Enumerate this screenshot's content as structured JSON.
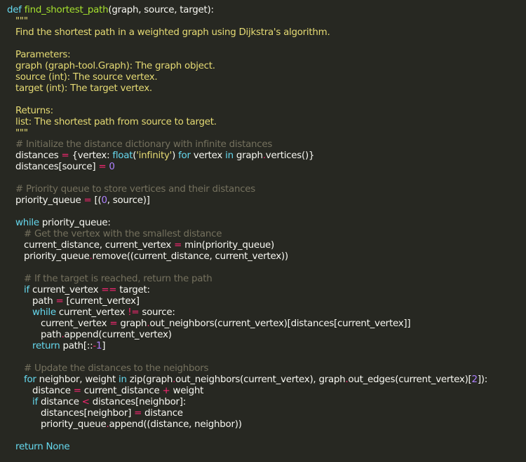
{
  "code_lines": [
    {
      "indent": 0,
      "tokens": [
        [
          "kw",
          "def"
        ],
        [
          "t",
          " "
        ],
        [
          "fn",
          "find_shortest_path"
        ],
        [
          "t",
          "(graph, source, target):"
        ]
      ]
    },
    {
      "indent": 1,
      "tokens": [
        [
          "doc",
          "\"\"\""
        ]
      ]
    },
    {
      "indent": 1,
      "tokens": [
        [
          "doc",
          "Find the shortest path in a weighted graph using Dijkstra's algorithm."
        ]
      ]
    },
    {
      "indent": 1,
      "tokens": []
    },
    {
      "indent": 1,
      "tokens": [
        [
          "doc",
          "Parameters:"
        ]
      ]
    },
    {
      "indent": 1,
      "tokens": [
        [
          "doc",
          "graph (graph-tool.Graph): The graph object."
        ]
      ]
    },
    {
      "indent": 1,
      "tokens": [
        [
          "doc",
          "source (int): The source vertex."
        ]
      ]
    },
    {
      "indent": 1,
      "tokens": [
        [
          "doc",
          "target (int): The target vertex."
        ]
      ]
    },
    {
      "indent": 1,
      "tokens": []
    },
    {
      "indent": 1,
      "tokens": [
        [
          "doc",
          "Returns:"
        ]
      ]
    },
    {
      "indent": 1,
      "tokens": [
        [
          "doc",
          "list: The shortest path from source to target."
        ]
      ]
    },
    {
      "indent": 1,
      "tokens": [
        [
          "doc",
          "\"\"\""
        ]
      ]
    },
    {
      "indent": 1,
      "tokens": [
        [
          "cm",
          "# Initialize the distance dictionary with infinite distances"
        ]
      ]
    },
    {
      "indent": 1,
      "tokens": [
        [
          "t",
          "distances "
        ],
        [
          "op",
          "="
        ],
        [
          "t",
          " {vertex: "
        ],
        [
          "kw",
          "float"
        ],
        [
          "t",
          "("
        ],
        [
          "str",
          "'infinity'"
        ],
        [
          "t",
          ") "
        ],
        [
          "kw",
          "for"
        ],
        [
          "t",
          " vertex "
        ],
        [
          "kw",
          "in"
        ],
        [
          "t",
          " graph"
        ],
        [
          "op",
          "."
        ],
        [
          "t",
          "vertices()}"
        ]
      ]
    },
    {
      "indent": 1,
      "tokens": [
        [
          "t",
          "distances[source] "
        ],
        [
          "op",
          "="
        ],
        [
          "t",
          " "
        ],
        [
          "num",
          "0"
        ]
      ]
    },
    {
      "indent": 1,
      "tokens": []
    },
    {
      "indent": 1,
      "tokens": [
        [
          "cm",
          "# Priority queue to store vertices and their distances"
        ]
      ]
    },
    {
      "indent": 1,
      "tokens": [
        [
          "t",
          "priority_queue "
        ],
        [
          "op",
          "="
        ],
        [
          "t",
          " [("
        ],
        [
          "num",
          "0"
        ],
        [
          "t",
          ", source)]"
        ]
      ]
    },
    {
      "indent": 1,
      "tokens": []
    },
    {
      "indent": 1,
      "tokens": [
        [
          "kw",
          "while"
        ],
        [
          "t",
          " priority_queue:"
        ]
      ]
    },
    {
      "indent": 2,
      "tokens": [
        [
          "cm",
          "# Get the vertex with the smallest distance"
        ]
      ]
    },
    {
      "indent": 2,
      "tokens": [
        [
          "t",
          "current_distance, current_vertex "
        ],
        [
          "op",
          "="
        ],
        [
          "t",
          " min(priority_queue)"
        ]
      ]
    },
    {
      "indent": 2,
      "tokens": [
        [
          "t",
          "priority_queue"
        ],
        [
          "op",
          "."
        ],
        [
          "t",
          "remove((current_distance, current_vertex))"
        ]
      ]
    },
    {
      "indent": 2,
      "tokens": []
    },
    {
      "indent": 2,
      "tokens": [
        [
          "cm",
          "# If the target is reached, return the path"
        ]
      ]
    },
    {
      "indent": 2,
      "tokens": [
        [
          "kw",
          "if"
        ],
        [
          "t",
          " current_vertex "
        ],
        [
          "op",
          "=="
        ],
        [
          "t",
          " target:"
        ]
      ]
    },
    {
      "indent": 3,
      "tokens": [
        [
          "t",
          "path "
        ],
        [
          "op",
          "="
        ],
        [
          "t",
          " [current_vertex]"
        ]
      ]
    },
    {
      "indent": 3,
      "tokens": [
        [
          "kw",
          "while"
        ],
        [
          "t",
          " current_vertex "
        ],
        [
          "op",
          "!="
        ],
        [
          "t",
          " source:"
        ]
      ]
    },
    {
      "indent": 4,
      "tokens": [
        [
          "t",
          "current_vertex "
        ],
        [
          "op",
          "="
        ],
        [
          "t",
          " graph"
        ],
        [
          "op",
          "."
        ],
        [
          "t",
          "out_neighbors(current_vertex)[distances[current_vertex]]"
        ]
      ]
    },
    {
      "indent": 4,
      "tokens": [
        [
          "t",
          "path"
        ],
        [
          "op",
          "."
        ],
        [
          "t",
          "append(current_vertex)"
        ]
      ]
    },
    {
      "indent": 3,
      "tokens": [
        [
          "kw",
          "return"
        ],
        [
          "t",
          " path[::"
        ],
        [
          "op",
          "-"
        ],
        [
          "num",
          "1"
        ],
        [
          "t",
          "]"
        ]
      ]
    },
    {
      "indent": 2,
      "tokens": []
    },
    {
      "indent": 2,
      "tokens": [
        [
          "cm",
          "# Update the distances to the neighbors"
        ]
      ]
    },
    {
      "indent": 2,
      "tokens": [
        [
          "kw",
          "for"
        ],
        [
          "t",
          " neighbor, weight "
        ],
        [
          "kw",
          "in"
        ],
        [
          "t",
          " zip(graph"
        ],
        [
          "op",
          "."
        ],
        [
          "t",
          "out_neighbors(current_vertex), graph"
        ],
        [
          "op",
          "."
        ],
        [
          "t",
          "out_edges(current_vertex)["
        ],
        [
          "num",
          "2"
        ],
        [
          "t",
          "]):"
        ]
      ]
    },
    {
      "indent": 3,
      "tokens": [
        [
          "t",
          "distance "
        ],
        [
          "op",
          "="
        ],
        [
          "t",
          " current_distance "
        ],
        [
          "op",
          "+"
        ],
        [
          "t",
          " weight"
        ]
      ]
    },
    {
      "indent": 3,
      "tokens": [
        [
          "kw",
          "if"
        ],
        [
          "t",
          " distance "
        ],
        [
          "op",
          "<"
        ],
        [
          "t",
          " distances[neighbor]:"
        ]
      ]
    },
    {
      "indent": 4,
      "tokens": [
        [
          "t",
          "distances[neighbor] "
        ],
        [
          "op",
          "="
        ],
        [
          "t",
          " distance"
        ]
      ]
    },
    {
      "indent": 4,
      "tokens": [
        [
          "t",
          "priority_queue"
        ],
        [
          "op",
          "."
        ],
        [
          "t",
          "append((distance, neighbor))"
        ]
      ]
    },
    {
      "indent": 1,
      "tokens": []
    },
    {
      "indent": 1,
      "tokens": [
        [
          "kw",
          "return"
        ],
        [
          "t",
          " "
        ],
        [
          "kw",
          "None"
        ]
      ]
    }
  ]
}
